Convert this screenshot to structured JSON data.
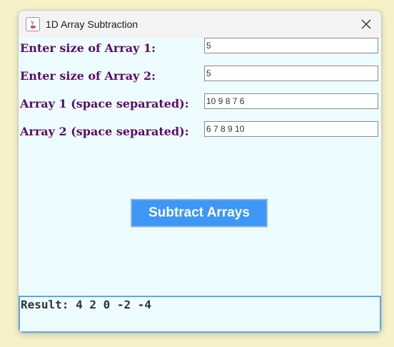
{
  "window": {
    "title": "1D Array Subtraction",
    "icon": "java-icon",
    "close_icon": "close-icon"
  },
  "form": {
    "size1_label": "Enter size of Array 1:",
    "size1_value": "5",
    "size2_label": "Enter size of Array 2:",
    "size2_value": "5",
    "array1_label": "Array 1 (space separated):",
    "array1_value": "10 9 8 7 6",
    "array2_label": "Array 2 (space separated):",
    "array2_value": "6 7 8 9 10"
  },
  "actions": {
    "subtract_label": "Subtract Arrays"
  },
  "result": {
    "text": "Result: 4 2 0 -2 -4"
  },
  "colors": {
    "label": "#5d0b68",
    "button": "#3d97f7",
    "content_bg": "#ecfcff",
    "result_border": "#5ba7e0"
  }
}
